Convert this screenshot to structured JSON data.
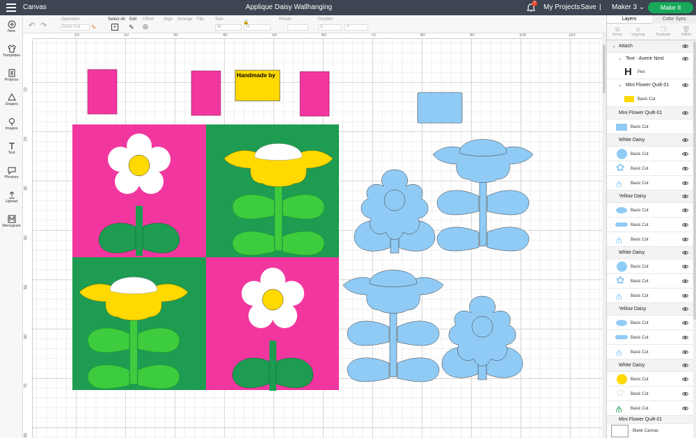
{
  "app": {
    "section": "Canvas",
    "project_title": "Applique Daisy Wallhanging",
    "notification_count": "7",
    "my_projects": "My Projects",
    "save": "Save",
    "separator": "|",
    "machine": "Maker 3",
    "make_it": "Make It"
  },
  "toolbar": {
    "operation_label": "Operation",
    "operation_value": "Basic Cut",
    "select_all": "Select All",
    "edit": "Edit",
    "offset": "Offset",
    "align": "Align",
    "arrange": "Arrange",
    "flip": "Flip",
    "size": "Size",
    "size_w": "W",
    "size_h": "H",
    "rotate": "Rotate",
    "position": "Position",
    "pos_x": "X",
    "pos_y": "Y"
  },
  "nav": [
    {
      "label": "New",
      "icon": "plus-circle-icon"
    },
    {
      "label": "Templates",
      "icon": "shirt-icon"
    },
    {
      "label": "Projects",
      "icon": "projects-icon"
    },
    {
      "label": "Shapes",
      "icon": "shapes-icon"
    },
    {
      "label": "Images",
      "icon": "lightbulb-icon"
    },
    {
      "label": "Text",
      "icon": "text-icon"
    },
    {
      "label": "Phrases",
      "icon": "speech-bubble-icon"
    },
    {
      "label": "Upload",
      "icon": "upload-icon"
    },
    {
      "label": "Monogram",
      "icon": "monogram-icon"
    }
  ],
  "ruler": {
    "top": [
      "10",
      "20",
      "30",
      "40",
      "50",
      "60",
      "70",
      "80",
      "90",
      "100",
      "110"
    ],
    "left": [
      "10",
      "20",
      "30",
      "40",
      "50",
      "60",
      "70",
      "80"
    ]
  },
  "canvas": {
    "handmade_text": "Handmade by",
    "colors": {
      "pink": "#f1379f",
      "green": "#1e9c52",
      "light_green": "#3dcc3d",
      "yellow": "#ffd900",
      "blue": "#90cbf5",
      "white": "#ffffff"
    }
  },
  "panel": {
    "tabs": [
      "Layers",
      "Color Sync"
    ],
    "actions": [
      "Group",
      "Ungroup",
      "Duplicate",
      "Delete"
    ],
    "layers": [
      {
        "type": "group",
        "label": "Attach",
        "indent": 0
      },
      {
        "type": "group",
        "label": "Text - Avenir Next",
        "indent": 1
      },
      {
        "type": "item",
        "label": "Pen",
        "thumb": "pen-letter-icon"
      },
      {
        "type": "group",
        "label": "Mini Flower Quilt-01",
        "indent": 1
      },
      {
        "type": "item",
        "label": "Basic Cut",
        "thumb": "yellow-rect-icon"
      },
      {
        "type": "header",
        "label": "Mini Flower Quilt-01"
      },
      {
        "type": "item",
        "label": "Basic Cut",
        "thumb": "blue-rect-icon"
      },
      {
        "type": "header",
        "label": "White Daisy"
      },
      {
        "type": "item",
        "label": "Basic Cut",
        "thumb": "blue-circle-icon"
      },
      {
        "type": "item",
        "label": "Basic Cut",
        "thumb": "blue-flower-icon"
      },
      {
        "type": "item",
        "label": "Basic Cut",
        "thumb": "blue-stem-icon"
      },
      {
        "type": "header",
        "label": "Yellow Daisy"
      },
      {
        "type": "item",
        "label": "Basic Cut",
        "thumb": "blue-cap-icon"
      },
      {
        "type": "item",
        "label": "Basic Cut",
        "thumb": "blue-petals-icon"
      },
      {
        "type": "item",
        "label": "Basic Cut",
        "thumb": "blue-stem-icon"
      },
      {
        "type": "header",
        "label": "White Daisy"
      },
      {
        "type": "item",
        "label": "Basic Cut",
        "thumb": "blue-circle-icon"
      },
      {
        "type": "item",
        "label": "Basic Cut",
        "thumb": "blue-flower-icon"
      },
      {
        "type": "item",
        "label": "Basic Cut",
        "thumb": "blue-stem-icon"
      },
      {
        "type": "header",
        "label": "Yellow Daisy"
      },
      {
        "type": "item",
        "label": "Basic Cut",
        "thumb": "blue-cap-icon"
      },
      {
        "type": "item",
        "label": "Basic Cut",
        "thumb": "blue-petals-icon"
      },
      {
        "type": "item",
        "label": "Basic Cut",
        "thumb": "blue-stem-icon"
      },
      {
        "type": "header",
        "label": "White Daisy"
      },
      {
        "type": "item",
        "label": "Basic Cut",
        "thumb": "yellow-circle-icon"
      },
      {
        "type": "item",
        "label": "Basic Cut",
        "thumb": "white-flower-icon"
      },
      {
        "type": "item",
        "label": "Basic Cut",
        "thumb": "green-stem-icon"
      },
      {
        "type": "header",
        "label": "Mini Flower Quilt-01"
      },
      {
        "type": "item",
        "label": "Blank Canvas",
        "thumb": "blank-canvas-icon"
      }
    ]
  }
}
